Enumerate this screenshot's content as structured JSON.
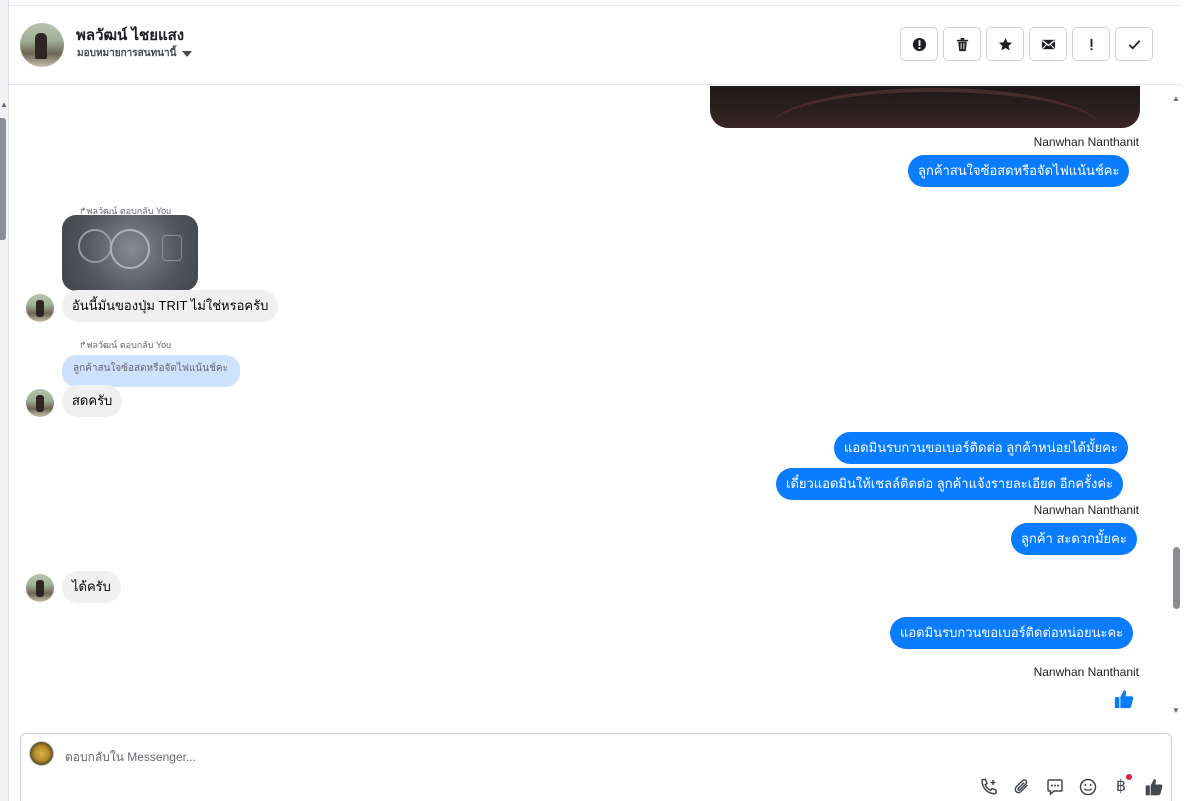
{
  "header": {
    "contact_name": "พลวัฒน์ ไชยแสง",
    "assign_label": "มอบหมายการสนทนานี้",
    "actions": [
      {
        "name": "spam-button",
        "icon": "alert-circle-icon"
      },
      {
        "name": "delete-button",
        "icon": "trash-icon"
      },
      {
        "name": "star-button",
        "icon": "star-icon"
      },
      {
        "name": "mark-unread-button",
        "icon": "envelope-icon"
      },
      {
        "name": "follow-up-button",
        "icon": "exclamation-icon"
      },
      {
        "name": "mark-done-button",
        "icon": "check-icon"
      }
    ]
  },
  "messages": {
    "sender_1": "Nanwhan Nanthanit",
    "out_1": "ลูกค้าสนใจซ้อสดหรือจัดไฟแน้นช์คะ",
    "reply_1_label": "พลวัฒน์ ตอบกลับ You",
    "in_1": "อันนี้มันของปุ่ม TRIT ไม่ใช่หรอครับ",
    "reply_2_label": "พลวัฒน์ ตอบกลับ You",
    "reply_2_quote": "ลูกค้าสนใจซ้อสดหรือจัดไฟแน้นช์คะ",
    "in_2": "สดครับ",
    "out_2": "แอดมินรบกวนขอเบอร์ติดต่อ ลูกค้าหน่อยได้มั้ยคะ",
    "out_3": "เดี๋ยวแอดมินให้เชลล์ติดต่อ ลูกค้าแจ้งรายละเอียด อีกครั้งค่ะ",
    "sender_2": "Nanwhan Nanthanit",
    "out_4": "ลูกค้า สะดวกมั้ยคะ",
    "in_3": "ได้ครับ",
    "out_5": "แอดมินรบกวนขอเบอร์ติดต่อหน่อยนะคะ",
    "sender_3": "Nanwhan Nanthanit",
    "like": "thumbs-up-icon"
  },
  "composer": {
    "placeholder": "ตอบกลับใน Messenger...",
    "tools": [
      "phone-plus-icon",
      "paperclip-icon",
      "chat-bubble-icon",
      "smiley-icon",
      "baht-icon",
      "thumbs-up-icon"
    ],
    "baht_symbol": "฿"
  },
  "colors": {
    "outgoing_bubble": "#0a7cff",
    "incoming_bubble": "#f0f0f0",
    "reply_quote": "#cfe2fd",
    "notification_dot": "#e41e3f"
  }
}
